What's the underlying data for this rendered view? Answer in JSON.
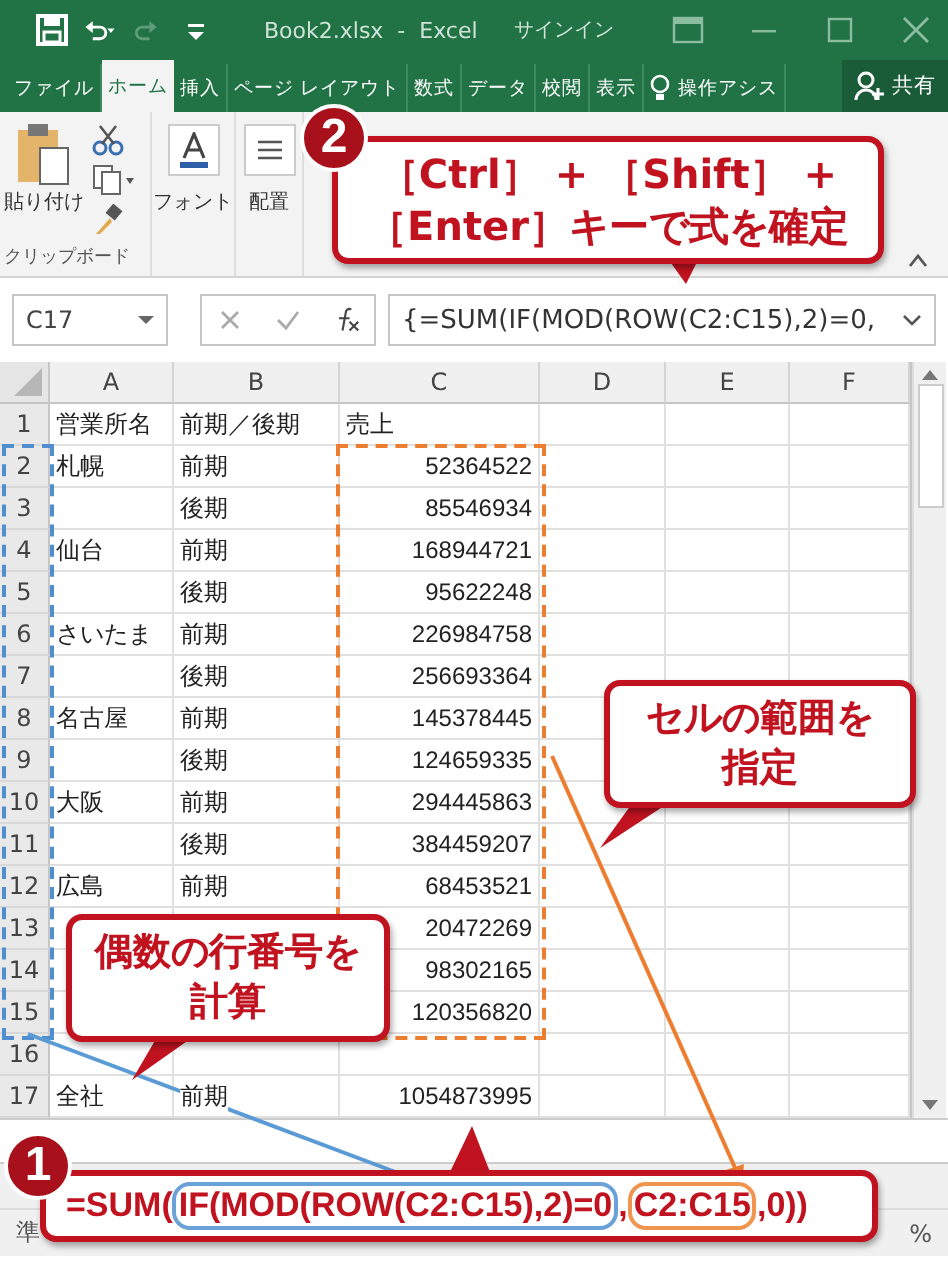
{
  "title_bar": {
    "title": "Book2.xlsx  -  Excel",
    "signin": "サインイン"
  },
  "ribbon_tabs": [
    {
      "label": "ファイル",
      "selected": false
    },
    {
      "label": "ホーム",
      "selected": true
    },
    {
      "label": "挿入",
      "selected": false
    },
    {
      "label": "ページ レイアウト",
      "selected": false
    },
    {
      "label": "数式",
      "selected": false
    },
    {
      "label": "データ",
      "selected": false
    },
    {
      "label": "校閲",
      "selected": false
    },
    {
      "label": "表示",
      "selected": false
    },
    {
      "label": "操作アシス",
      "selected": false,
      "kind": "assist"
    }
  ],
  "share": "共有",
  "ribbon": {
    "paste": "貼り付け",
    "clipboard": "クリップボード",
    "font": "フォント",
    "alignment": "配置"
  },
  "formula_bar": {
    "name_box": "C17",
    "formula": "{=SUM(IF(MOD(ROW(C2:C15),2)=0,"
  },
  "sheet": {
    "columns": [
      "A",
      "B",
      "C",
      "D",
      "E",
      "F"
    ],
    "rows": [
      {
        "number": "1",
        "kind": "header",
        "cells": {
          "a": "営業所名",
          "b": "前期／後期",
          "c": "売上"
        }
      },
      {
        "number": "2",
        "cells": {
          "a": "札幌",
          "b": "前期",
          "c": "52364522"
        }
      },
      {
        "number": "3",
        "cells": {
          "b": "後期",
          "c": "85546934"
        }
      },
      {
        "number": "4",
        "cells": {
          "a": "仙台",
          "b": "前期",
          "c": "168944721"
        }
      },
      {
        "number": "5",
        "cells": {
          "b": "後期",
          "c": "95622248"
        }
      },
      {
        "number": "6",
        "cells": {
          "a": "さいたま",
          "b": "前期",
          "c": "226984758"
        }
      },
      {
        "number": "7",
        "cells": {
          "b": "後期",
          "c": "256693364"
        }
      },
      {
        "number": "8",
        "cells": {
          "a": "名古屋",
          "b": "前期",
          "c": "145378445"
        }
      },
      {
        "number": "9",
        "cells": {
          "b": "後期",
          "c": "124659335"
        }
      },
      {
        "number": "10",
        "cells": {
          "a": "大阪",
          "b": "前期",
          "c": "294445863"
        }
      },
      {
        "number": "11",
        "cells": {
          "b": "後期",
          "c": "384459207"
        }
      },
      {
        "number": "12",
        "cells": {
          "a": "広島",
          "b": "前期",
          "c": "68453521"
        }
      },
      {
        "number": "13",
        "cells": {
          "c": "20472269"
        }
      },
      {
        "number": "14",
        "cells": {
          "c": "98302165"
        }
      },
      {
        "number": "15",
        "cells": {
          "c": "120356820"
        }
      },
      {
        "number": "16",
        "cells": {}
      },
      {
        "number": "17",
        "cells": {
          "a": "全社",
          "b": "前期",
          "c": "1054873995"
        }
      }
    ]
  },
  "status_bar": {
    "left": "準",
    "right": "%"
  },
  "callouts": [
    {
      "kind": "top",
      "number": "2",
      "lines": [
        "［Ctrl］ + ［Shift］ +",
        "［Enter］キーで式を確定"
      ]
    },
    {
      "kind": "range",
      "lines": [
        "セルの範囲を",
        "指定"
      ]
    },
    {
      "kind": "rows",
      "lines": [
        "偶数の行番号を",
        "計算"
      ]
    }
  ],
  "formula_callout": {
    "number": "1",
    "segments": [
      {
        "kind": "plain",
        "text": "=SUM("
      },
      {
        "kind": "rows",
        "text": "IF(MOD(ROW(C2:C15),2)=0"
      },
      {
        "kind": "plain",
        "text": ","
      },
      {
        "kind": "range",
        "text": "C2:C15"
      },
      {
        "kind": "plain",
        "text": ",0))"
      }
    ]
  }
}
